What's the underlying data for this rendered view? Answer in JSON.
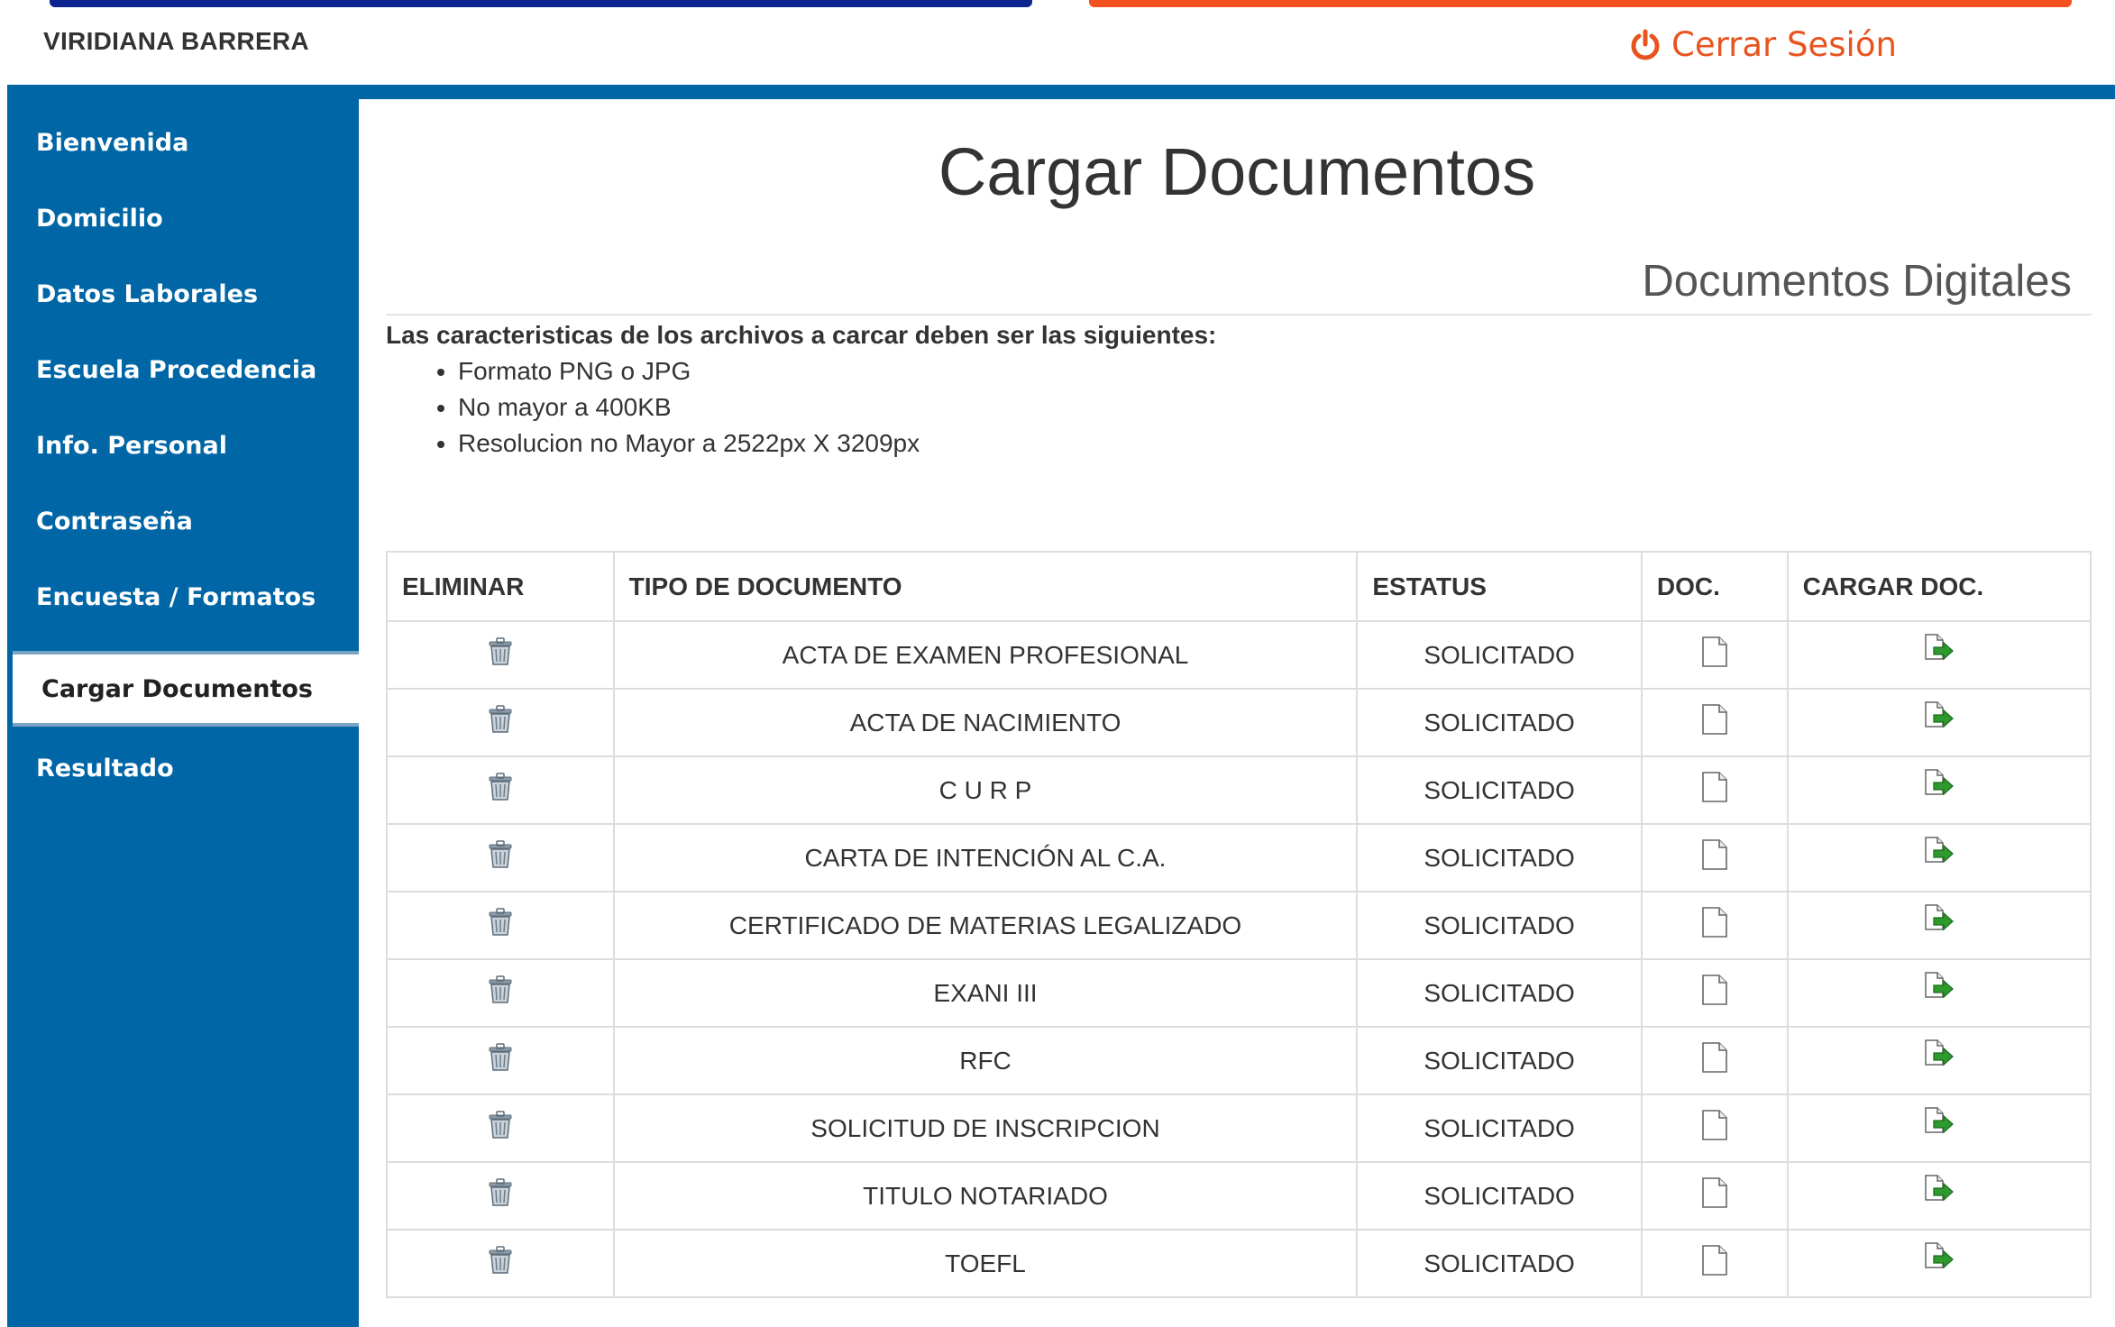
{
  "header": {
    "user_name": "VIRIDIANA BARRERA",
    "logout_label": "Cerrar Sesión",
    "colors": {
      "blue_bar": "#0d2390",
      "orange_bar": "#f4511e",
      "logout": "#e8541e",
      "stripe": "#0066a6"
    }
  },
  "sidebar": {
    "items": [
      {
        "label": "Bienvenida",
        "active": false
      },
      {
        "label": "Domicilio",
        "active": false
      },
      {
        "label": "Datos Laborales",
        "active": false
      },
      {
        "label": "Escuela Procedencia",
        "active": false
      },
      {
        "label": "Info. Personal",
        "active": false
      },
      {
        "label": "Contraseña",
        "active": false
      },
      {
        "label": "Encuesta / Formatos",
        "active": false
      },
      {
        "label": "Cargar Documentos",
        "active": true
      },
      {
        "label": "Resultado",
        "active": false
      }
    ],
    "background": "#0066a6"
  },
  "main": {
    "title": "Cargar Documentos",
    "section_title": "Documentos Digitales",
    "requirements_heading": "Las caracteristicas de los archivos a carcar deben ser las siguientes:",
    "requirements": [
      "Formato PNG o JPG",
      "No mayor a 400KB",
      "Resolucion no Mayor a 2522px X 3209px"
    ]
  },
  "table": {
    "headers": [
      "ELIMINAR",
      "TIPO DE DOCUMENTO",
      "ESTATUS",
      "DOC.",
      "CARGAR DOC."
    ],
    "rows": [
      {
        "type": "ACTA DE EXAMEN PROFESIONAL",
        "status": "SOLICITADO"
      },
      {
        "type": "ACTA DE NACIMIENTO",
        "status": "SOLICITADO"
      },
      {
        "type": "C U R P",
        "status": "SOLICITADO"
      },
      {
        "type": "CARTA DE INTENCIÓN AL C.A.",
        "status": "SOLICITADO"
      },
      {
        "type": "CERTIFICADO DE MATERIAS LEGALIZADO",
        "status": "SOLICITADO"
      },
      {
        "type": "EXANI III",
        "status": "SOLICITADO"
      },
      {
        "type": "RFC",
        "status": "SOLICITADO"
      },
      {
        "type": "SOLICITUD DE INSCRIPCION",
        "status": "SOLICITADO"
      },
      {
        "type": "TITULO NOTARIADO",
        "status": "SOLICITADO"
      },
      {
        "type": "TOEFL",
        "status": "SOLICITADO"
      }
    ],
    "icons": {
      "delete": "trash-icon",
      "doc": "document-icon",
      "upload": "upload-arrow-icon"
    }
  }
}
